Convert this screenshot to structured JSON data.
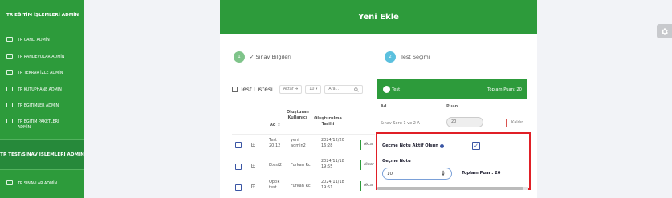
{
  "sidebar": {
    "header": "TR EĞİTİM İŞLEMLERİ ADMİN",
    "items": [
      {
        "label": "TR CANLI ADMİN",
        "icon": "monitor-icon"
      },
      {
        "label": "TR RANDEVULAR ADMİN",
        "icon": "calendar-icon"
      },
      {
        "label": "TR TEKRAR İZLE ADMİN",
        "icon": "video-icon"
      },
      {
        "label": "TR KÜTÜPHANE ADMİN",
        "icon": "library-icon"
      },
      {
        "label": "TR EĞİTİMLER ADMİN",
        "icon": "book-icon"
      },
      {
        "label": "TR EĞİTİM PAKETLERİ ADMİN",
        "icon": "folder-icon"
      }
    ],
    "section": "TR TEST/SINAV İŞLEMLERİ ADMİN",
    "section_items": [
      {
        "label": "TR SINAVLAR ADMİN",
        "icon": "edit-icon"
      }
    ]
  },
  "modal": {
    "title": "Yeni Ekle",
    "steps": [
      {
        "num": "1",
        "label": "✓ Sınav Bilgileri",
        "color": "#7fc48a"
      },
      {
        "num": "2",
        "label": "Test Seçimi",
        "color": "#5bc0de"
      }
    ]
  },
  "list": {
    "title": "Test Listesi",
    "aktar_btn": "Aktar ➔",
    "page_size": "10 ▾",
    "search_placeholder": "Ara...",
    "columns": [
      "Ad",
      "Oluşturan Kullanıcı",
      "Oluşturulma Tarihi"
    ],
    "rows": [
      {
        "ad": "Test 20.12",
        "user": "yeni admin2",
        "date": "2024/12/20 16:28",
        "action": "Aktar"
      },
      {
        "ad": "Etest2",
        "user": "Furkan Rc",
        "date": "2024/11/18 19:55",
        "action": "Aktar"
      },
      {
        "ad": "Optik test",
        "user": "Furkan Rc",
        "date": "2024/11/18 19:51",
        "action": "Aktar"
      }
    ]
  },
  "selected": {
    "title": "Test",
    "total_label": "Toplam Puan: 20",
    "col_ad": "Ad",
    "col_puan": "Puan",
    "row": {
      "name": "Sınav Soru 1 ve 2 A",
      "puan": "20",
      "action": "Kaldır"
    },
    "pass_active_label": "Geçme Notu Aktif Olsun",
    "pass_active_checked": true,
    "pass_label": "Geçme Notu",
    "pass_value": "10",
    "total_bottom": "Toplam Puan: 20"
  },
  "colors": {
    "brand": "#2d9b3b",
    "highlight": "#e01f26"
  }
}
